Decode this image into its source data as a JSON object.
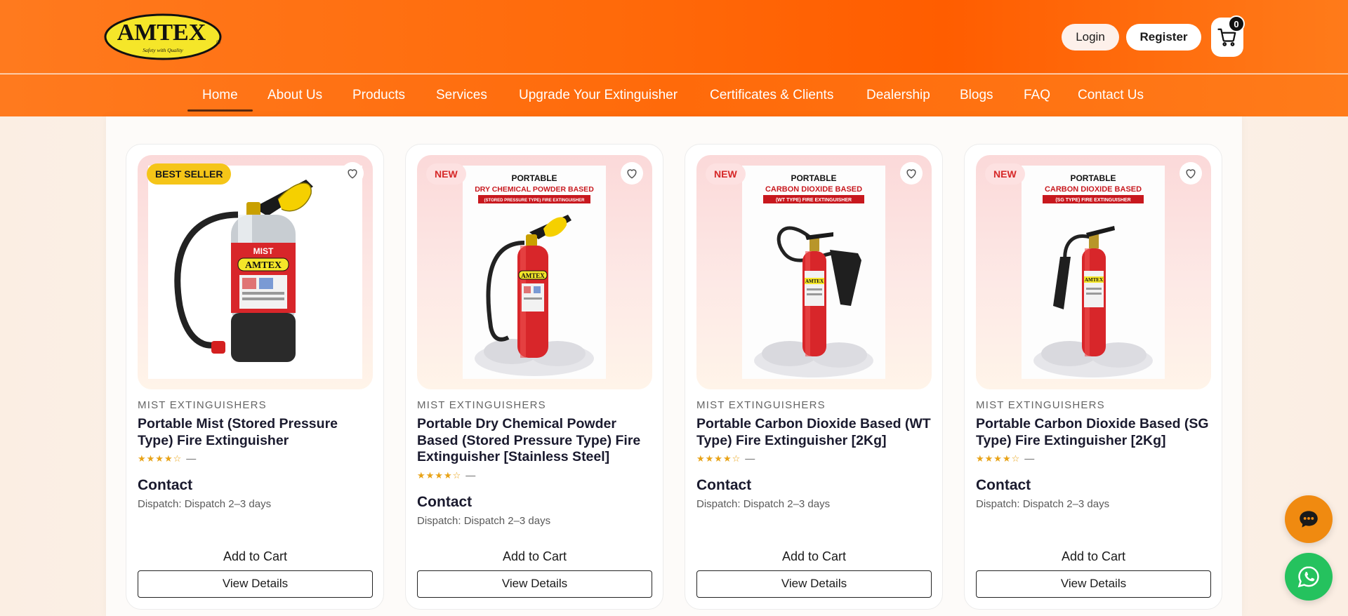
{
  "brand": {
    "name": "AMTEX",
    "tagline": "Safety with Quality",
    "primary_color": "#ff6a0a",
    "logo_yellow": "#f5e629"
  },
  "header": {
    "login_label": "Login",
    "register_label": "Register",
    "cart_count": "0"
  },
  "nav": {
    "items": [
      {
        "label": "Home",
        "active": true
      },
      {
        "label": "About Us"
      },
      {
        "label": "Products"
      },
      {
        "label": "Services"
      },
      {
        "label": "Upgrade Your Extinguisher"
      },
      {
        "label": "Certificates & Clients"
      },
      {
        "label": "Dealership"
      },
      {
        "label": "Blogs"
      },
      {
        "label": "FAQ"
      },
      {
        "label": "Contact Us"
      }
    ]
  },
  "products": [
    {
      "badge": "BEST SELLER",
      "badge_type": "best",
      "category": "MIST EXTINGUISHERS",
      "title": "Portable Mist (Stored Pressure Type) Fire Extinguisher",
      "rating_stars": "★★★★☆",
      "rating_text": "—",
      "price": "Contact",
      "dispatch": "Dispatch: Dispatch 2–3 days",
      "add_to_cart": "Add to Cart",
      "view_details": "View Details",
      "image": {
        "label_lines": [],
        "brand_text": "AMTEX",
        "mist_text": "MIST"
      }
    },
    {
      "badge": "NEW",
      "badge_type": "new",
      "category": "MIST EXTINGUISHERS",
      "title": "Portable Dry Chemical Powder Based (Stored Pressure Type) Fire Extinguisher [Stainless Steel]",
      "rating_stars": "★★★★☆",
      "rating_text": "—",
      "price": "Contact",
      "dispatch": "Dispatch: Dispatch 2–3 days",
      "add_to_cart": "Add to Cart",
      "view_details": "View Details",
      "image": {
        "line1": "PORTABLE",
        "line2": "DRY CHEMICAL POWDER BASED",
        "line3": "(STORED PRESSURE TYPE) FIRE EXTINGUISHER",
        "brand_text": "AMTEX"
      }
    },
    {
      "badge": "NEW",
      "badge_type": "new",
      "category": "MIST EXTINGUISHERS",
      "title": "Portable Carbon Dioxide Based (WT Type) Fire Extinguisher [2Kg]",
      "rating_stars": "★★★★☆",
      "rating_text": "—",
      "price": "Contact",
      "dispatch": "Dispatch: Dispatch 2–3 days",
      "add_to_cart": "Add to Cart",
      "view_details": "View Details",
      "image": {
        "line1": "PORTABLE",
        "line2": "CARBON DIOXIDE BASED",
        "line3": "(WT TYPE) FIRE EXTINGUISHER",
        "brand_text": "AMTEX"
      }
    },
    {
      "badge": "NEW",
      "badge_type": "new",
      "category": "MIST EXTINGUISHERS",
      "title": "Portable Carbon Dioxide Based (SG Type) Fire Extinguisher [2Kg]",
      "rating_stars": "★★★★☆",
      "rating_text": "—",
      "price": "Contact",
      "dispatch": "Dispatch: Dispatch 2–3 days",
      "add_to_cart": "Add to Cart",
      "view_details": "View Details",
      "image": {
        "line1": "PORTABLE",
        "line2": "CARBON DIOXIDE BASED",
        "line3": "(SG TYPE) FIRE EXTINGUISHER",
        "brand_text": "AMTEX"
      }
    }
  ],
  "floating": {
    "chat_icon": "chat-bubble-icon",
    "whatsapp_icon": "whatsapp-icon"
  }
}
